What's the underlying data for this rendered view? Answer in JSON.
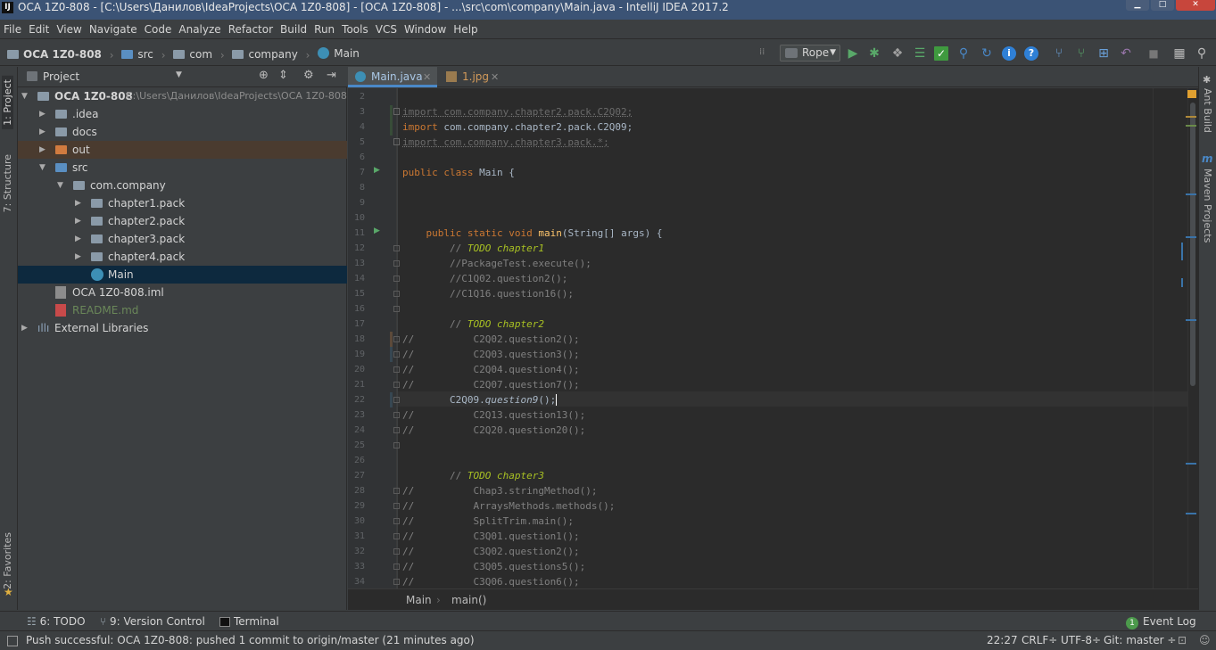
{
  "window": {
    "title": "OCA 1Z0-808 - [C:\\Users\\Данилов\\IdeaProjects\\OCA 1Z0-808] - [OCA 1Z0-808] - ...\\src\\com\\company\\Main.java - IntelliJ IDEA 2017.2"
  },
  "menu": [
    "File",
    "Edit",
    "View",
    "Navigate",
    "Code",
    "Analyze",
    "Refactor",
    "Build",
    "Run",
    "Tools",
    "VCS",
    "Window",
    "Help"
  ],
  "nav": {
    "project": "OCA 1Z0-808",
    "crumbs": [
      "src",
      "com",
      "company",
      "Main"
    ],
    "run_config": "Rope"
  },
  "left_tabs": {
    "project": "1: Project",
    "structure": "7: Structure",
    "favorites": "2: Favorites"
  },
  "right_tabs": {
    "ant": "Ant Build",
    "maven": "Maven Projects"
  },
  "project_panel": {
    "title": "Project",
    "root_name": "OCA 1Z0-808",
    "root_path": "C:\\Users\\Данилов\\IdeaProjects\\OCA 1Z0-808",
    "items": [
      {
        "label": ".idea"
      },
      {
        "label": "docs"
      },
      {
        "label": "out"
      },
      {
        "label": "src"
      },
      {
        "label": "com.company"
      },
      {
        "label": "chapter1.pack"
      },
      {
        "label": "chapter2.pack"
      },
      {
        "label": "chapter3.pack"
      },
      {
        "label": "chapter4.pack"
      },
      {
        "label": "Main"
      },
      {
        "label": "OCA 1Z0-808.iml"
      },
      {
        "label": "README.md"
      },
      {
        "label": "External Libraries"
      }
    ]
  },
  "editor_tabs": [
    {
      "label": "Main.java"
    },
    {
      "label": "1.jpg"
    }
  ],
  "code": {
    "line_numbers": [
      "2",
      "3",
      "4",
      "5",
      "6",
      "7",
      "8",
      "9",
      "10",
      "11",
      "12",
      "13",
      "14",
      "15",
      "16",
      "17",
      "18",
      "19",
      "20",
      "21",
      "22",
      "23",
      "24",
      "25",
      "26",
      "27",
      "28",
      "29",
      "30",
      "31",
      "32",
      "33",
      "34"
    ],
    "lines": [
      "",
      "import com.company.chapter2.pack.C2Q02;",
      "import com.company.chapter2.pack.C2Q09;",
      "import com.company.chapter3.pack.*;",
      "",
      "public class Main {",
      "",
      "",
      "",
      "    public static void main(String[] args) {",
      "        // TODO chapter1",
      "        //PackageTest.execute();",
      "        //C1Q02.question2();",
      "        //C1Q16.question16();",
      "",
      "        // TODO chapter2",
      "//          C2Q02.question2();",
      "//          C2Q03.question3();",
      "//          C2Q04.question4();",
      "//          C2Q07.question7();",
      "        C2Q09.question9();",
      "//          C2Q13.question13();",
      "//          C2Q20.question20();",
      "",
      "",
      "        // TODO chapter3",
      "//          Chap3.stringMethod();",
      "//          ArraysMethods.methods();",
      "//          SplitTrim.main();",
      "//          C3Q01.question1();",
      "//          C3Q02.question2();",
      "//          C3Q05.questions5();",
      "//          C3Q06.question6();"
    ]
  },
  "editor_breadcrumb": {
    "class": "Main",
    "method": "main()"
  },
  "tool_windows": {
    "todo": "6: TODO",
    "vcs": "9: Version Control",
    "terminal": "Terminal",
    "event_log": "Event Log",
    "event_count": "1"
  },
  "status": {
    "message": "Push successful: OCA 1Z0-808: pushed 1 commit to origin/master (21 minutes ago)",
    "position": "22:27",
    "line_sep": "CRLF÷",
    "encoding": "UTF-8÷",
    "git": "Git: master ÷"
  },
  "colors": {
    "keyword": "#cc7832",
    "comment": "#808080",
    "todo": "#a8c023",
    "method": "#ffc66d",
    "selection": "#0d293e"
  }
}
